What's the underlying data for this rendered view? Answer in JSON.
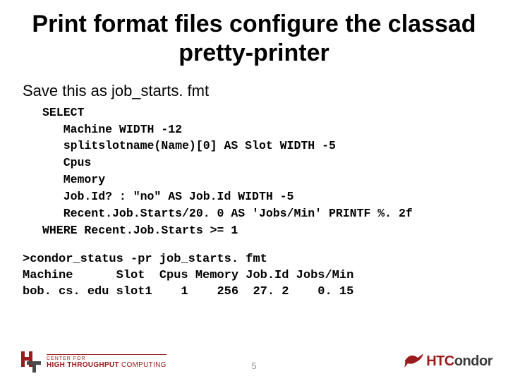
{
  "title": "Print format files configure the classad pretty-printer",
  "subhead": "Save this as job_starts. fmt",
  "code": "SELECT\n   Machine WIDTH -12\n   splitslotname(Name)[0] AS Slot WIDTH -5\n   Cpus\n   Memory\n   Job.Id? : \"no\" AS Job.Id WIDTH -5\n   Recent.Job.Starts/20. 0 AS 'Jobs/Min' PRINTF %. 2f\nWHERE Recent.Job.Starts >= 1",
  "output": ">condor_status -pr job_starts. fmt\nMachine      Slot  Cpus Memory Job.Id Jobs/Min\nbob. cs. edu slot1    1    256  27. 2    0. 15",
  "page_number": "5",
  "logo_left": {
    "line1": "CENTER FOR",
    "line2_a": "HIGH THROUGHPUT",
    "line2_b": " COMPUTING"
  },
  "logo_right": {
    "part1": "HTC",
    "part2": "ondor"
  }
}
